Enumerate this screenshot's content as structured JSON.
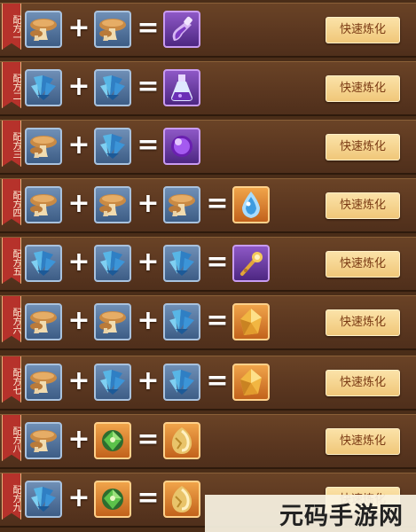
{
  "button_label": "快速炼化",
  "watermark": "元码手游网",
  "operators": {
    "plus": "+",
    "equals": "="
  },
  "recipes": [
    {
      "label": "配方一",
      "inputs": [
        "mushroom",
        "mushroom"
      ],
      "result": {
        "icon": "purple-potion-icon",
        "frame": "purple"
      }
    },
    {
      "label": "配方二",
      "inputs": [
        "crystal",
        "crystal"
      ],
      "result": {
        "icon": "purple-flask-icon",
        "frame": "purple"
      }
    },
    {
      "label": "配方三",
      "inputs": [
        "mushroom",
        "crystal"
      ],
      "result": {
        "icon": "purple-orb-icon",
        "frame": "purple"
      }
    },
    {
      "label": "配方四",
      "inputs": [
        "mushroom",
        "mushroom",
        "mushroom"
      ],
      "result": {
        "icon": "ice-crystal-icon",
        "frame": "orange"
      }
    },
    {
      "label": "配方五",
      "inputs": [
        "crystal",
        "crystal",
        "crystal"
      ],
      "result": {
        "icon": "golden-staff-icon",
        "frame": "purple"
      }
    },
    {
      "label": "配方六",
      "inputs": [
        "mushroom",
        "mushroom",
        "crystal"
      ],
      "result": {
        "icon": "amber-shard-icon",
        "frame": "orange"
      }
    },
    {
      "label": "配方七",
      "inputs": [
        "mushroom",
        "crystal",
        "crystal"
      ],
      "result": {
        "icon": "amber-shard-icon",
        "frame": "orange"
      }
    },
    {
      "label": "配方八",
      "inputs": [
        "mushroom",
        "green-gem"
      ],
      "result": {
        "icon": "golden-egg-icon",
        "frame": "orange"
      }
    },
    {
      "label": "配方九",
      "inputs": [
        "crystal",
        "green-gem"
      ],
      "result": {
        "icon": "golden-egg-icon",
        "frame": "orange"
      }
    }
  ]
}
